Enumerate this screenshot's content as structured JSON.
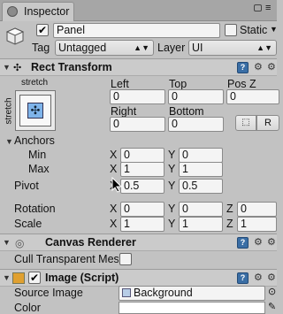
{
  "tab": {
    "title": "Inspector",
    "lock_icon": "lock-icon",
    "menu_icon": "tab-menu-icon"
  },
  "header": {
    "name_value": "Panel",
    "active_checked": true,
    "static_label": "Static",
    "tag_label": "Tag",
    "tag_value": "Untagged",
    "layer_label": "Layer",
    "layer_value": "UI"
  },
  "rect_transform": {
    "title": "Rect Transform",
    "anchor_preset_top": "stretch",
    "anchor_preset_side": "stretch",
    "left_label": "Left",
    "top_label": "Top",
    "posz_label": "Pos Z",
    "left_value": "0",
    "top_value": "0",
    "posz_value": "0",
    "right_label": "Right",
    "bottom_label": "Bottom",
    "right_value": "0",
    "bottom_value": "0",
    "r_button": "R",
    "anchors_label": "Anchors",
    "min_label": "Min",
    "min_x": "0",
    "min_y": "0",
    "max_label": "Max",
    "max_x": "1",
    "max_y": "1",
    "pivot_label": "Pivot",
    "pivot_x": "0.5",
    "pivot_y": "0.5",
    "rotation_label": "Rotation",
    "rot_x": "0",
    "rot_y": "0",
    "rot_z": "0",
    "scale_label": "Scale",
    "scale_x": "1",
    "scale_y": "1",
    "scale_z": "1",
    "x": "X",
    "y": "Y",
    "z": "Z"
  },
  "canvas_renderer": {
    "title": "Canvas Renderer",
    "cull_label": "Cull Transparent Mesh"
  },
  "image_script": {
    "title": "Image (Script)",
    "source_label": "Source Image",
    "source_value": "Background",
    "color_label": "Color"
  },
  "colors": {
    "accent": "#3a6ea5",
    "panel": "#c2c2c2",
    "header": "#cbcbcb"
  }
}
